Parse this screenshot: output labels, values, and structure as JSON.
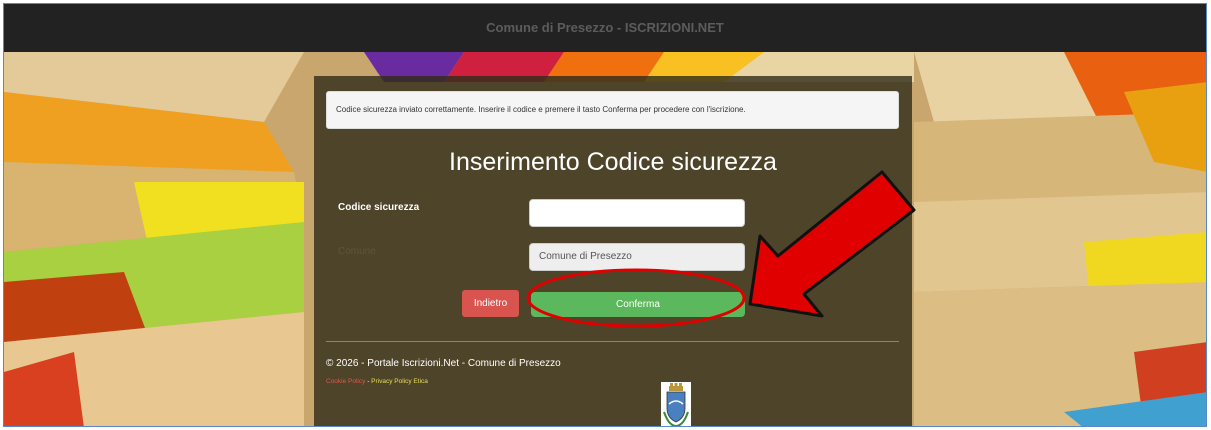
{
  "header": {
    "title": "Comune di Presezzo - ISCRIZIONI.NET"
  },
  "alert": {
    "message": "Codice sicurezza inviato correttamente. Inserire il codice e premere il tasto Conferma per procedere con l'iscrizione."
  },
  "form": {
    "title": "Inserimento Codice sicurezza",
    "code_label": "Codice sicurezza",
    "code_value": "",
    "comune_label": "Comune",
    "comune_value": "Comune di Presezzo",
    "back_label": "Indietro",
    "confirm_label": "Conferma"
  },
  "footer": {
    "copyright": "© 2026 - Portale Iscrizioni.Net - Comune di Presezzo",
    "cookie_label": "Cookie Policy",
    "separator": " - ",
    "privacy_label": "Privacy Policy Etica"
  },
  "colors": {
    "danger": "#d9534f",
    "success": "#5cb85c",
    "annotation_red": "#e00000"
  },
  "icons": {
    "crest": "municipal-crest-icon",
    "annotation": "red-arrow-icon"
  }
}
